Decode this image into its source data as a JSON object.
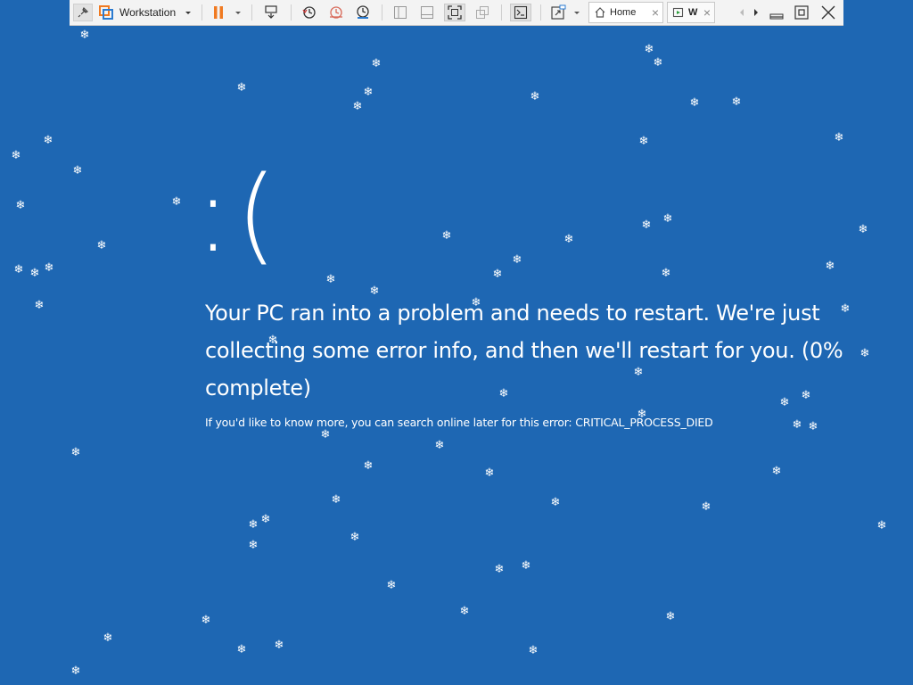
{
  "toolbar": {
    "library_label": "Workstation",
    "tabs": [
      {
        "label": "Home"
      },
      {
        "label": "W"
      }
    ],
    "colors": {
      "pause": "#f07a21",
      "background": "#f3f3f3"
    }
  },
  "bsod": {
    "face": ":(",
    "message": "Your PC ran into a problem and needs to restart. We're just collecting some error info, and then we'll restart for you. (0% complete)",
    "progress_percent": 0,
    "detail": "If you'd like to know more, you can search online later for this error: CRITICAL_PROCESS_DIED",
    "background_color": "#1e67b3"
  },
  "snowflake_glyph": "❄"
}
